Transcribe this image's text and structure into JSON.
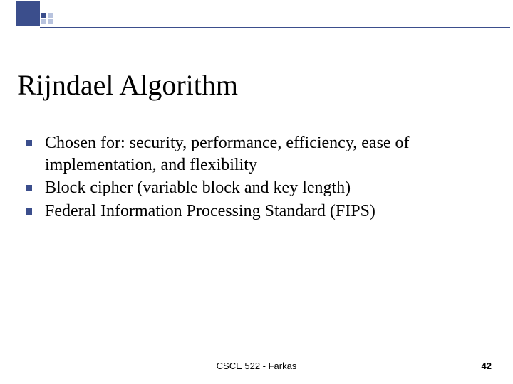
{
  "title": "Rijndael Algorithm",
  "bullets": [
    "Chosen for: security, performance, efficiency, ease of implementation, and flexibility",
    "Block cipher (variable block and key length)",
    "Federal Information Processing Standard (FIPS)"
  ],
  "footer": "CSCE 522 - Farkas",
  "pageNumber": "42"
}
